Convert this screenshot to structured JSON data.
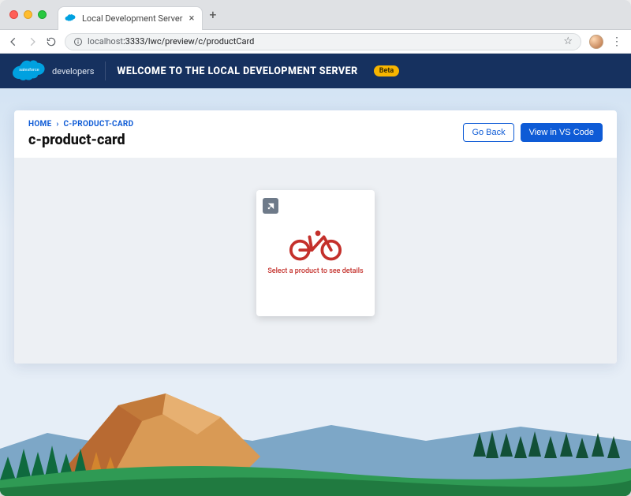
{
  "browser": {
    "tab_title": "Local Development Server",
    "url_host_prefix": "localhost",
    "url_port_path": ":3333/lwc/preview/c/productCard"
  },
  "header": {
    "logo_text_top": "salesforce",
    "logo_text_right": "developers",
    "welcome": "WELCOME TO THE LOCAL DEVELOPMENT SERVER",
    "beta_label": "Beta"
  },
  "breadcrumb": {
    "home": "HOME",
    "current": "C-PRODUCT-CARD"
  },
  "page": {
    "title": "c-product-card"
  },
  "actions": {
    "go_back": "Go Back",
    "view_vscode": "View in VS Code"
  },
  "card": {
    "caption": "Select a product to see details"
  },
  "colors": {
    "brand_navy": "#16315f",
    "primary_blue": "#0e5bd6",
    "beta_yellow": "#f7b500",
    "accent_red": "#c4302b"
  }
}
